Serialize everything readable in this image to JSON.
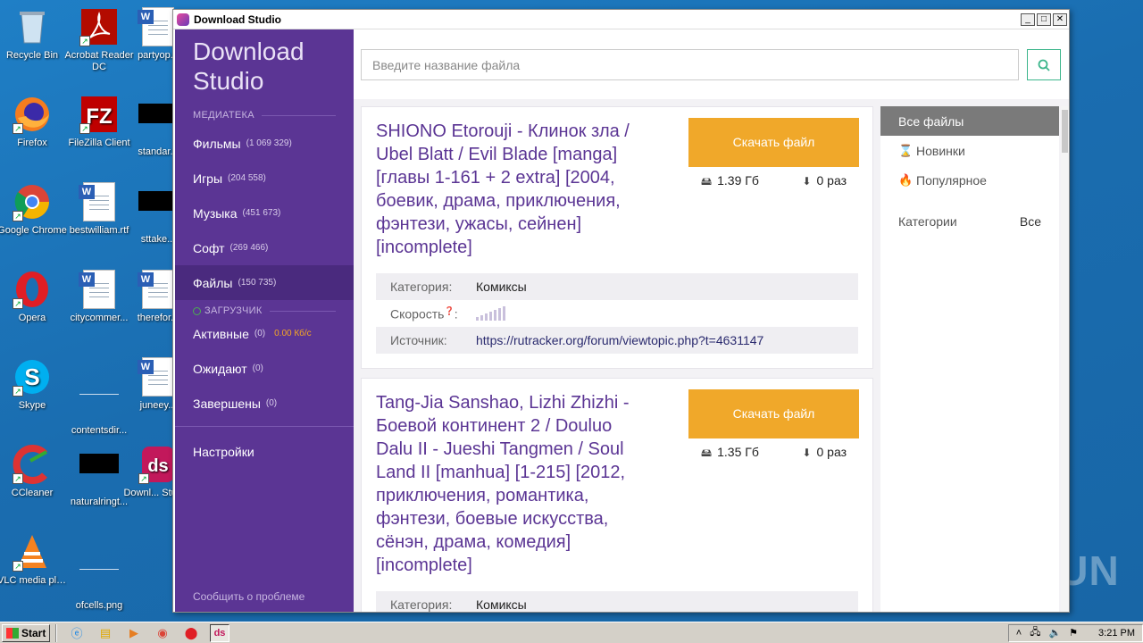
{
  "desktop": {
    "icons": [
      {
        "label": "Recycle Bin"
      },
      {
        "label": "Acrobat Reader DC"
      },
      {
        "label": "partyop..."
      },
      {
        "label": "Firefox"
      },
      {
        "label": "FileZilla Client"
      },
      {
        "label": "standar..."
      },
      {
        "label": "Google Chrome"
      },
      {
        "label": "bestwilliam.rtf"
      },
      {
        "label": "sttake..."
      },
      {
        "label": "Opera"
      },
      {
        "label": "citycommer..."
      },
      {
        "label": "therefor..."
      },
      {
        "label": "Skype"
      },
      {
        "label": "contentsdir..."
      },
      {
        "label": "juneey..."
      },
      {
        "label": "CCleaner"
      },
      {
        "label": "naturalringt..."
      },
      {
        "label": "Downl... Studi..."
      },
      {
        "label": "VLC media player"
      },
      {
        "label": "ofcells.png"
      }
    ],
    "watermark": "ANY RUN"
  },
  "window": {
    "title": "Download Studio",
    "controls": [
      "_",
      "□",
      "✕"
    ]
  },
  "sidebar": {
    "logo": "Download Studio",
    "library_header": "МЕДИАТЕКА",
    "library_items": [
      {
        "label": "Фильмы",
        "count": "(1 069 329)"
      },
      {
        "label": "Игры",
        "count": "(204 558)"
      },
      {
        "label": "Музыка",
        "count": "(451 673)"
      },
      {
        "label": "Софт",
        "count": "(269 466)"
      },
      {
        "label": "Файлы",
        "count": "(150 735)"
      }
    ],
    "downloader_header": "ЗАГРУЗЧИК",
    "downloader_items": [
      {
        "label": "Активные",
        "count": "(0)",
        "speed": "0.00 Кб/с"
      },
      {
        "label": "Ожидают",
        "count": "(0)"
      },
      {
        "label": "Завершены",
        "count": "(0)"
      }
    ],
    "settings": "Настройки",
    "report": "Сообщить о проблеме"
  },
  "search": {
    "placeholder": "Введите название файла"
  },
  "results": [
    {
      "title": "SHIONO Etorouji - Клинок зла / Ubel Blatt / Evil Blade [manga] [главы 1-161 + 2 extra] [2004, боевик, драма, приключения, фэнтези, ужасы, сейнен] [incomplete]",
      "button": "Скачать файл",
      "size": "1.39 Гб",
      "downloads": "0 раз",
      "category_label": "Категория:",
      "category": "Комиксы",
      "speed_label": "Скорость",
      "speed_level": 0,
      "source_label": "Источник:",
      "source": "https://rutracker.org/forum/viewtopic.php?t=4631147"
    },
    {
      "title": "Tang-Jia Sanshao, Lizhi Zhizhi - Боевой континент 2 / Douluo Dalu II - Jueshi Tangmen / Soul Land II [manhua] [1-215] [2012, приключения, романтика, фэнтези, боевые искусства, сёнэн, драма, комедия] [incomplete]",
      "button": "Скачать файл",
      "size": "1.35 Гб",
      "downloads": "0 раз",
      "category_label": "Категория:",
      "category": "Комиксы"
    }
  ],
  "filters": {
    "items": [
      {
        "label": "Все файлы",
        "icon": ""
      },
      {
        "label": "Новинки",
        "icon": "hourglass-icon"
      },
      {
        "label": "Популярное",
        "icon": "flame-icon"
      }
    ],
    "category_label": "Категории",
    "category_value": "Все"
  },
  "taskbar": {
    "start": "Start",
    "clock": "3:21 PM"
  }
}
